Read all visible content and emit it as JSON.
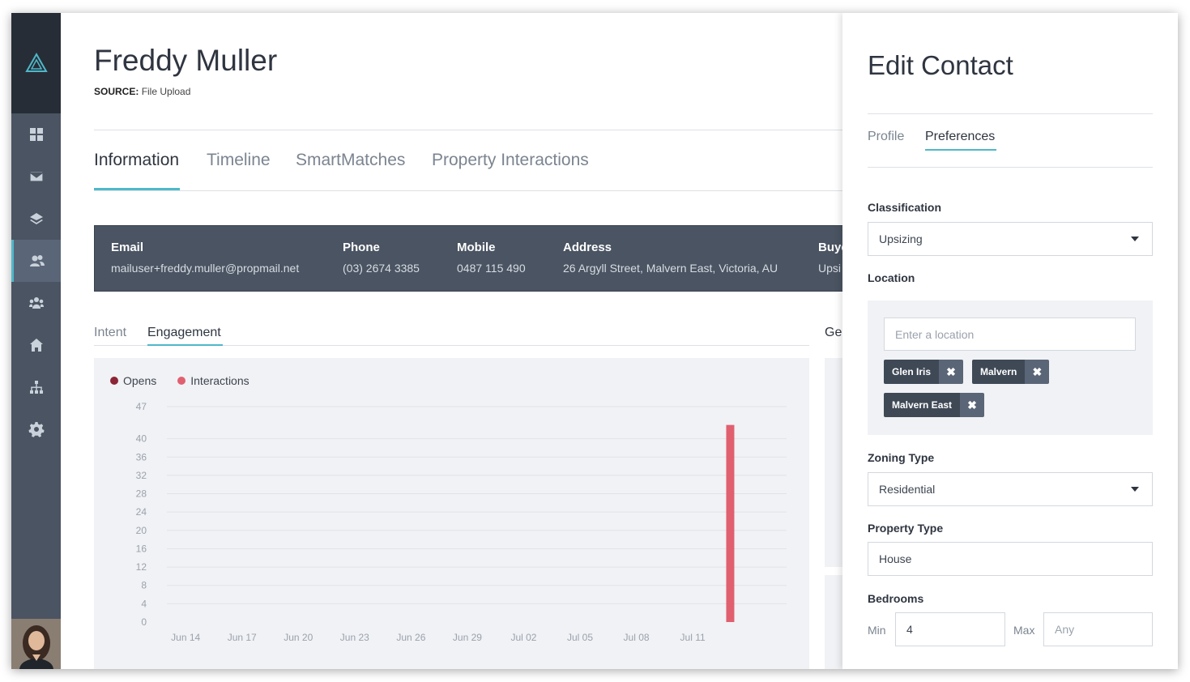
{
  "contact": {
    "name": "Freddy Muller",
    "source_label": "SOURCE:",
    "source_value": "File Upload"
  },
  "tabs": [
    {
      "label": "Information",
      "active": true
    },
    {
      "label": "Timeline"
    },
    {
      "label": "SmartMatches"
    },
    {
      "label": "Property Interactions"
    }
  ],
  "info": {
    "email": {
      "label": "Email",
      "value": "mailuser+freddy.muller@propmail.net"
    },
    "phone": {
      "label": "Phone",
      "value": "(03) 2674 3385"
    },
    "mobile": {
      "label": "Mobile",
      "value": "0487 115 490"
    },
    "address": {
      "label": "Address",
      "value": "26 Argyll Street, Malvern East, Victoria, AU"
    },
    "buyer": {
      "label": "Buye",
      "value": "Upsi"
    }
  },
  "subtabs": [
    {
      "label": "Intent"
    },
    {
      "label": "Engagement",
      "active": true
    }
  ],
  "side_heading": "Ge",
  "chart_data": {
    "type": "bar",
    "series": [
      {
        "name": "Opens",
        "color": "#8b2535",
        "values": [
          0
        ]
      },
      {
        "name": "Interactions",
        "color": "#e06070",
        "values": [
          43
        ]
      }
    ],
    "bars": [
      {
        "x": "Jul 13",
        "series": "Interactions",
        "value": 43
      }
    ],
    "yticks": [
      0,
      4,
      8,
      12,
      16,
      20,
      24,
      28,
      32,
      36,
      40,
      47
    ],
    "ylim": [
      0,
      47
    ],
    "xticks": [
      "Jun 14",
      "Jun 17",
      "Jun 20",
      "Jun 23",
      "Jun 26",
      "Jun 29",
      "Jul 02",
      "Jul 05",
      "Jul 08",
      "Jul 11"
    ],
    "xrange": [
      "Jun 13",
      "Jul 16"
    ],
    "grid": true,
    "legend_position": "top-left"
  },
  "panel": {
    "title": "Edit Contact",
    "tabs": [
      {
        "label": "Profile"
      },
      {
        "label": "Preferences",
        "active": true
      }
    ],
    "classification": {
      "label": "Classification",
      "value": "Upsizing"
    },
    "location": {
      "label": "Location",
      "placeholder": "Enter a location",
      "chips": [
        "Glen Iris",
        "Malvern",
        "Malvern East"
      ]
    },
    "zoning": {
      "label": "Zoning Type",
      "value": "Residential"
    },
    "property_type": {
      "label": "Property Type",
      "value": "House"
    },
    "bedrooms": {
      "label": "Bedrooms",
      "min_label": "Min",
      "min_value": "4",
      "max_label": "Max",
      "max_placeholder": "Any"
    }
  },
  "icons": {
    "remove_chip": "✖"
  },
  "colors": {
    "accent": "#4fb8c9",
    "sidebar": "#4a5462",
    "sidebar_dark": "#262d37",
    "opens": "#8b2535",
    "interactions": "#e06070"
  }
}
